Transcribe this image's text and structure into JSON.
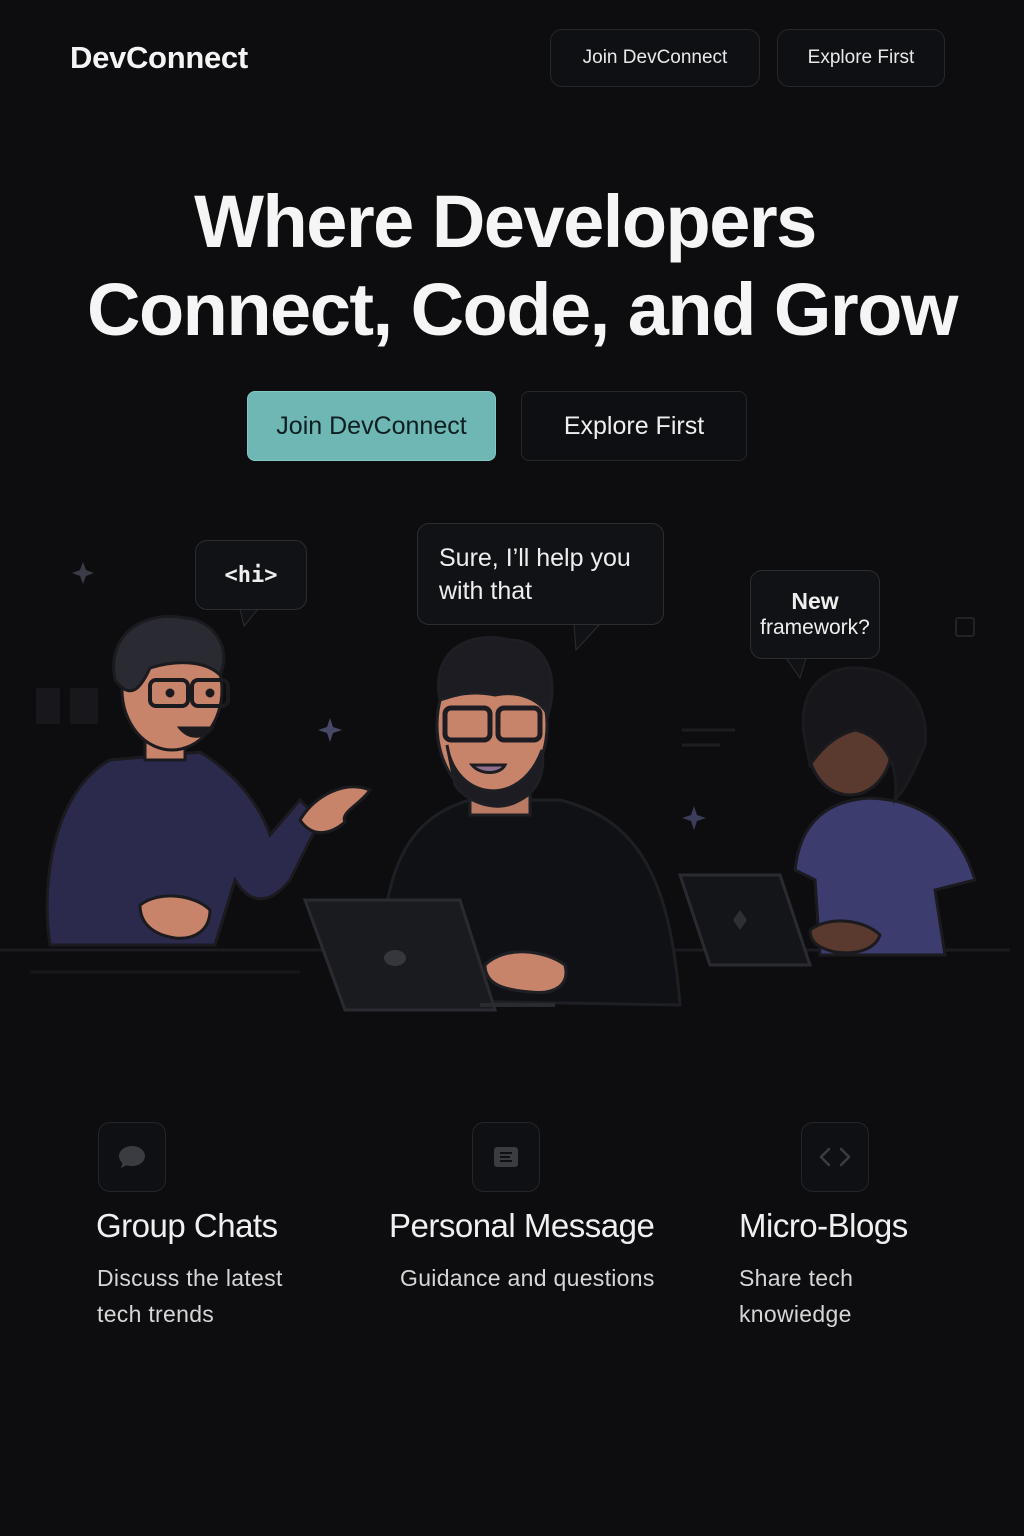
{
  "header": {
    "logo": "DevConnect",
    "nav": [
      {
        "label": "Join DevConnect"
      },
      {
        "label": "Explore First"
      }
    ]
  },
  "hero": {
    "title_line1": "Where Developers",
    "title_line2": "Connect, Code, and Grow",
    "cta_primary": "Join DevConnect",
    "cta_secondary": "Explore First"
  },
  "illustration": {
    "bubble_left": "<hi>",
    "bubble_center_line1": "Sure, I’ll help you",
    "bubble_center_line2": "with that",
    "bubble_right_line1": "New",
    "bubble_right_line2": "framework?"
  },
  "features": [
    {
      "icon": "chat-bubble-icon",
      "title": "Group Chats",
      "desc_line1": "Discuss the latest",
      "desc_line2": "tech trends"
    },
    {
      "icon": "message-icon",
      "title": "Personal Message",
      "desc_line1": "Guidance and questions",
      "desc_line2": ""
    },
    {
      "icon": "code-brackets-icon",
      "title": "Micro-Blogs",
      "desc_line1": "Share tech",
      "desc_line2": "knowiedge"
    }
  ],
  "colors": {
    "background": "#0d0d0f",
    "accent": "#6fb7b5",
    "shirt_left": "#2b2a4d",
    "shirt_right": "#3d3c6e",
    "skin": "#c7846a"
  }
}
